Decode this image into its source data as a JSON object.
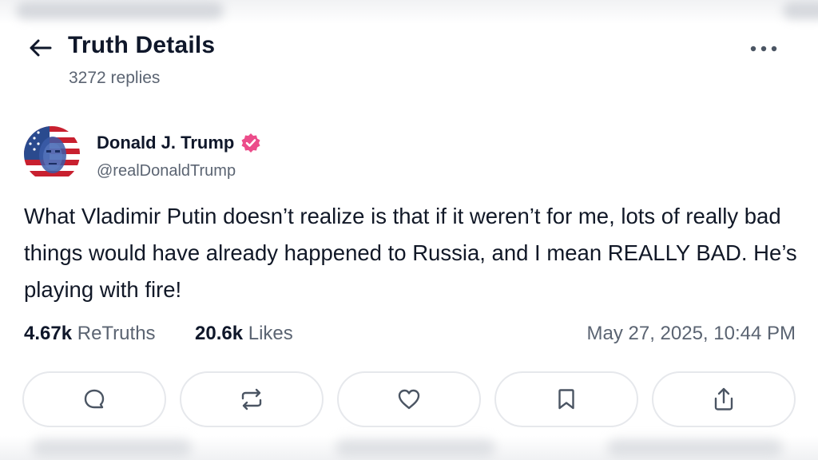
{
  "header": {
    "title": "Truth Details",
    "replies": "3272 replies",
    "back_icon": "arrow-left-icon",
    "more_icon": "more-horizontal-icon"
  },
  "post": {
    "author": {
      "display_name": "Donald J. Trump",
      "handle": "@realDonaldTrump",
      "verified": true,
      "verified_color": "#ec4c8a"
    },
    "text": "What Vladimir Putin doesn’t realize is that if it weren’t for me, lots of really bad things would have already happened to Russia, and I mean REALLY BAD. He’s playing with fire!",
    "retruths_count": "4.67k",
    "retruths_label": "ReTruths",
    "likes_count": "20.6k",
    "likes_label": "Likes",
    "timestamp": "May 27, 2025, 10:44 PM"
  },
  "actions": [
    {
      "name": "reply",
      "icon": "reply-bubble-icon"
    },
    {
      "name": "retruth",
      "icon": "repost-icon"
    },
    {
      "name": "like",
      "icon": "heart-icon"
    },
    {
      "name": "bookmark",
      "icon": "bookmark-icon"
    },
    {
      "name": "share",
      "icon": "share-icon"
    }
  ],
  "colors": {
    "text_primary": "#0f172a",
    "text_secondary": "#5b6472",
    "button_border": "#e6e8ec",
    "icon": "#4b5563"
  }
}
